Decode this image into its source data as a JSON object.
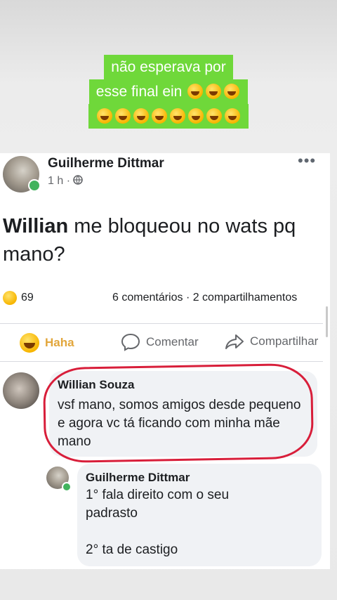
{
  "caption": {
    "line1": "não esperava por",
    "line2": "esse final ein",
    "line2_emoji_count": 3,
    "line3_emoji_count": 8,
    "emoji": "rolling-on-floor-laughing"
  },
  "post": {
    "author": "Guilherme Dittmar",
    "time": "1 h ·",
    "more": "•••",
    "text_bold": "Willian",
    "text_rest": " me bloqueou no wats pq mano?",
    "reaction_count": "69",
    "stats": "6 comentários · 2 compartilhamentos",
    "actions": {
      "haha": "Haha",
      "comment": "Comentar",
      "share": "Compartilhar"
    }
  },
  "comments": [
    {
      "author": "Willian Souza",
      "text": "vsf mano, somos amigos desde pequeno e agora vc tá ficando com minha mãe mano"
    },
    {
      "author": "Guilherme Dittmar",
      "line1": "1° fala direito com o seu",
      "line2": "padrasto",
      "line3": "2° ta de castigo"
    }
  ],
  "colors": {
    "caption_bg": "#6fd83a",
    "highlight_ring": "#d81e3a",
    "online": "#41b35d",
    "haha": "#e2a63b"
  }
}
